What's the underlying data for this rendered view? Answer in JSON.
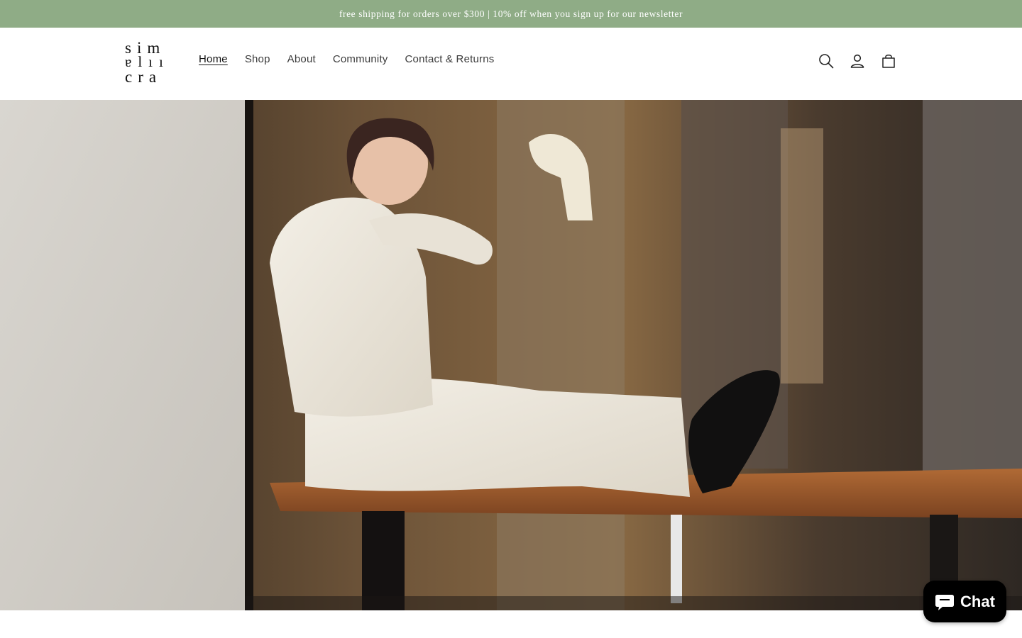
{
  "announcement": {
    "text": "free shipping for orders over $300 | 10% off when you sign up for our newsletter"
  },
  "brand": {
    "logo_lines": [
      "sim",
      "ɐlıı",
      "cra"
    ],
    "accent_color": "#8fac86"
  },
  "nav": {
    "items": [
      {
        "label": "Home",
        "active": true
      },
      {
        "label": "Shop",
        "active": false
      },
      {
        "label": "About",
        "active": false
      },
      {
        "label": "Community",
        "active": false
      },
      {
        "label": "Contact & Returns",
        "active": false
      }
    ]
  },
  "header_icons": [
    "search-icon",
    "account-icon",
    "cart-icon"
  ],
  "hero": {
    "image_description_icon": "hero-photo"
  },
  "chat": {
    "label": "Chat",
    "icon": "chat-bubble-icon"
  }
}
